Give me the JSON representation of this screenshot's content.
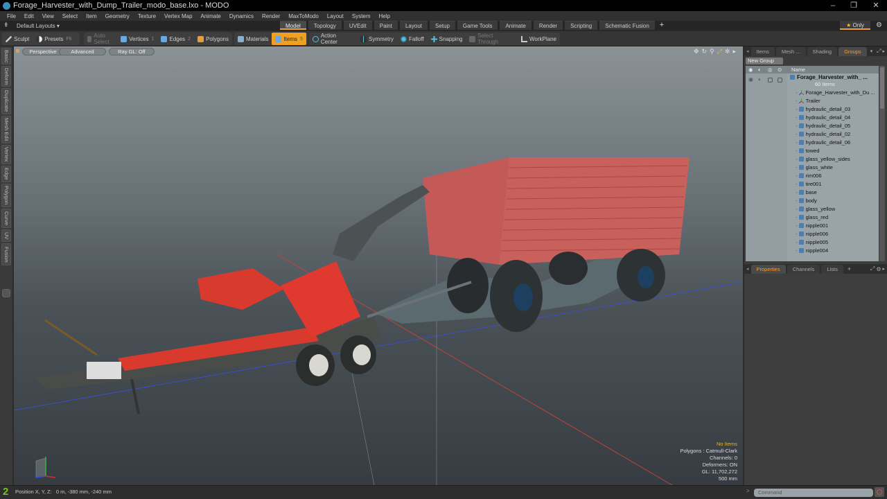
{
  "window": {
    "title": "Forage_Harvester_with_Dump_Trailer_modo_base.lxo - MODO",
    "controls": {
      "minimize": "–",
      "maximize": "❐",
      "close": "✕"
    }
  },
  "menu": [
    "File",
    "Edit",
    "View",
    "Select",
    "Item",
    "Geometry",
    "Texture",
    "Vertex Map",
    "Animate",
    "Dynamics",
    "Render",
    "MaxToModo",
    "Layout",
    "System",
    "Help"
  ],
  "layoutbar": {
    "layouts_label": "Default Layouts ▾",
    "tabs": [
      "Model",
      "Topology",
      "UVEdit",
      "Paint",
      "Layout",
      "Setup",
      "Game Tools",
      "Animate",
      "Render",
      "Scripting",
      "Schematic Fusion"
    ],
    "active_tab": "Model",
    "add_tab": "+",
    "only_label": "Only",
    "gear": "⚙"
  },
  "toolbar": {
    "sculpt": "Sculpt",
    "presets": "Presets",
    "presets_key": "F6",
    "auto_select": "Auto Select",
    "vertices": "Vertices",
    "vertices_key": "1",
    "edges": "Edges",
    "edges_key": "2",
    "polygons": "Polygons",
    "materials": "Materials",
    "items": "Items",
    "items_key": "5",
    "action_center": "Action Center",
    "symmetry": "Symmetry",
    "falloff": "Falloff",
    "snapping": "Snapping",
    "select_through": "Select Through",
    "workplane": "WorkPlane"
  },
  "left_tabs": [
    "Basic",
    "Deform",
    "Duplicate",
    "Mesh Edit",
    "Vertex",
    "Edge",
    "Polygon",
    "Curve",
    "UV",
    "Fusion"
  ],
  "viewport": {
    "buttons": [
      "Perspective",
      "Advanced",
      "Ray GL: Off"
    ],
    "info": {
      "selection": "No Items",
      "polygons": "Polygons : Catmull-Clark",
      "channels": "Channels: 0",
      "deformers": "Deformers: ON",
      "gl": "GL: 11,702,272",
      "scale": "500 mm"
    },
    "colors": {
      "harvester_red": "#d93a2e",
      "trailer_red": "#c45a58",
      "grid_x": "#c0443a",
      "grid_z": "#3c4fc8"
    }
  },
  "groups_panel": {
    "tabs": [
      "Items",
      "Mesh ...",
      "Shading",
      "Groups"
    ],
    "active_tab": "Groups",
    "new_group": "New Group",
    "column_name": "Name",
    "root": {
      "name": "Forage_Harvester_with_ ...",
      "count": "60 Items"
    },
    "items": [
      {
        "name": "Forage_Harvester_with_Du ...",
        "type": "locator"
      },
      {
        "name": "Trailer",
        "type": "locator"
      },
      {
        "name": "hydraulic_detail_03",
        "type": "mesh"
      },
      {
        "name": "hydraulic_detail_04",
        "type": "mesh"
      },
      {
        "name": "hydraulic_detail_05",
        "type": "mesh"
      },
      {
        "name": "hydraulic_detail_02",
        "type": "mesh"
      },
      {
        "name": "hydraulic_detail_06",
        "type": "mesh"
      },
      {
        "name": "towed",
        "type": "mesh"
      },
      {
        "name": "glass_yellow_sides",
        "type": "mesh"
      },
      {
        "name": "glass_white",
        "type": "mesh"
      },
      {
        "name": "rim006",
        "type": "mesh"
      },
      {
        "name": "tire001",
        "type": "mesh"
      },
      {
        "name": "base",
        "type": "mesh"
      },
      {
        "name": "body",
        "type": "mesh"
      },
      {
        "name": "glass_yellow",
        "type": "mesh"
      },
      {
        "name": "glass_red",
        "type": "mesh"
      },
      {
        "name": "nipple001",
        "type": "mesh"
      },
      {
        "name": "nipple006",
        "type": "mesh"
      },
      {
        "name": "nipple005",
        "type": "mesh"
      },
      {
        "name": "nipple004",
        "type": "mesh"
      }
    ]
  },
  "properties_panel": {
    "tabs": [
      "Properties",
      "Channels",
      "Lists"
    ],
    "active_tab": "Properties",
    "add_tab": "+"
  },
  "statusbar": {
    "layer_num": "2",
    "position": "Position X, Y, Z:   0 m, -380 mm, -240 mm",
    "command_placeholder": "Command"
  }
}
